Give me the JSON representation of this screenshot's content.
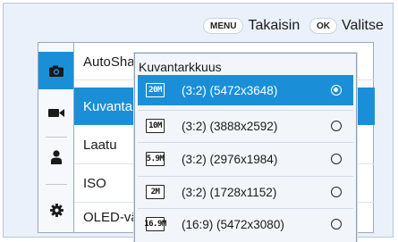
{
  "hints": {
    "back_key": "MENU",
    "back_label": "Takaisin",
    "select_key": "OK",
    "select_label": "Valitse"
  },
  "side_icons": [
    {
      "name": "camera-icon",
      "active": true
    },
    {
      "name": "video-icon",
      "active": false
    },
    {
      "name": "person-icon",
      "active": false
    },
    {
      "name": "gear-icon",
      "active": false
    }
  ],
  "menu": {
    "items": [
      {
        "label": "AutoSha",
        "active": false
      },
      {
        "label": "Kuvantar",
        "active": true
      },
      {
        "label": "Laatu",
        "active": false
      },
      {
        "label": "ISO",
        "active": false
      },
      {
        "label": "OLED-vä",
        "active": false
      }
    ]
  },
  "popup": {
    "title": "Kuvantarkkuus",
    "options": [
      {
        "badge": "20M",
        "label": "(3:2) (5472x3648)",
        "selected": true
      },
      {
        "badge": "10M",
        "label": "(3:2) (3888x2592)",
        "selected": false
      },
      {
        "badge": "5.9M",
        "label": "(3:2) (2976x1984)",
        "selected": false
      },
      {
        "badge": "2M",
        "label": "(3:2) (1728x1152)",
        "selected": false
      },
      {
        "badge": "16.9M",
        "label": "(16:9) (5472x3080)",
        "selected": false
      }
    ]
  }
}
